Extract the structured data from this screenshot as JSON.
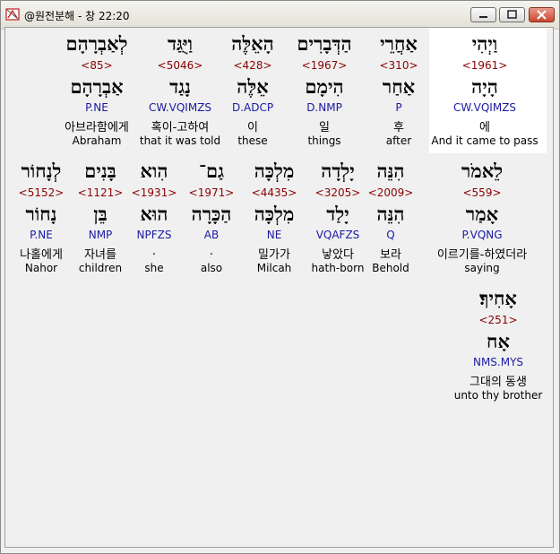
{
  "window": {
    "title": "@원전분해 - 창 22:20",
    "icons": {
      "app": "bible-app-icon",
      "min": "minimize-icon",
      "max": "maximize-icon",
      "close": "close-icon"
    }
  },
  "rows": [
    [
      {
        "word": "וַיְהִי",
        "strong": "<1961>",
        "lemma": "הָיָה",
        "morph": "CW.VQIMZS",
        "kor": "에",
        "eng": "And it came to pass"
      },
      {
        "word": "אַחֲרֵי",
        "strong": "<310>",
        "lemma": "אַחַר",
        "morph": "P",
        "kor": "후",
        "eng": "after"
      },
      {
        "word": "הַדְּבָרִים",
        "strong": "<1967>",
        "lemma": "הִימָם",
        "morph": "D.NMP",
        "kor": "일",
        "eng": "things"
      },
      {
        "word": "הָאֵלֶּה",
        "strong": "<428>",
        "lemma": "אֵלֶּה",
        "morph": "D.ADCP",
        "kor": "이",
        "eng": "these"
      },
      {
        "word": "וַיֻּגַּד",
        "strong": "<5046>",
        "lemma": "נָגַד",
        "morph": "CW.VQIMZS",
        "kor": "혹이-고하여",
        "eng": "that it was told"
      },
      {
        "word": "לְאַבְרָהָם",
        "strong": "<85>",
        "lemma": "אַבְרָהָם",
        "morph": "P.NE",
        "kor": "아브라함에게",
        "eng": "Abraham"
      }
    ],
    [
      {
        "word": "לֵאמֹר",
        "strong": "<559>",
        "lemma": "אָמַר",
        "morph": "P.VQNG",
        "kor": "이르기를-하였더라",
        "eng": "saying"
      },
      {
        "word": "הִנֵּה",
        "strong": "<2009>",
        "lemma": "הִנֵּה",
        "morph": "Q",
        "kor": "보라",
        "eng": "Behold"
      },
      {
        "word": "יָלְדָה",
        "strong": "<3205>",
        "lemma": "יָלַד",
        "morph": "VQAFZS",
        "kor": "낳았다",
        "eng": "hath-born"
      },
      {
        "word": "מִלְכָּה",
        "strong": "<4435>",
        "lemma": "מִלְכָּה",
        "morph": "NE",
        "kor": "밀가가",
        "eng": "Milcah"
      },
      {
        "word": "גַם־",
        "strong": "<1971>",
        "lemma": "הַכָּרָה",
        "morph": "AB",
        "kor": ".",
        "eng": "also"
      },
      {
        "word": "הִוא",
        "strong": "<1931>",
        "lemma": "הוּא",
        "morph": "NPFZS",
        "kor": ".",
        "eng": "she"
      },
      {
        "word": "בָּנִים",
        "strong": "<1121>",
        "lemma": "בֵּן",
        "morph": "NMP",
        "kor": "자녀를",
        "eng": "children"
      },
      {
        "word": "לְנָחוֹר",
        "strong": "<5152>",
        "lemma": "נָחוֹר",
        "morph": "P.NE",
        "kor": "나홀에게",
        "eng": "Nahor"
      }
    ],
    [
      {
        "word": "אָחִיךָ׃",
        "strong": "<251>",
        "lemma": "אָח",
        "morph": "NMS.MYS",
        "kor": "그대의 동생",
        "eng": "unto thy brother"
      }
    ]
  ]
}
